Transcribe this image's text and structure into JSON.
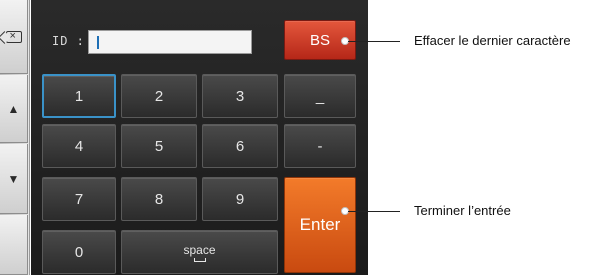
{
  "side_buttons": {
    "up_glyph": "▲",
    "down_glyph": "▼",
    "delete_glyph": "×"
  },
  "id_field": {
    "label": "ID :",
    "value": ""
  },
  "keys": {
    "row1": [
      "1",
      "2",
      "3",
      "_"
    ],
    "row2": [
      "4",
      "5",
      "6",
      "-"
    ],
    "row3": [
      "7",
      "8",
      "9"
    ],
    "zero": "0",
    "space": "space",
    "backspace": "BS",
    "enter": "Enter"
  },
  "callouts": {
    "backspace": "Effacer le dernier caractère",
    "enter": "Terminer l’entrée"
  },
  "colors": {
    "panel": "#222222",
    "key": "#3b3b3b",
    "backspace_key": "#c93a22",
    "enter_key": "#e35f1a",
    "selected_outline": "#3a92c8"
  }
}
